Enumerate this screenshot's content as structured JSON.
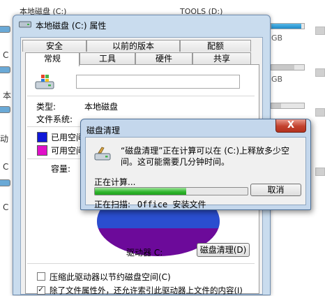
{
  "background": {
    "drive_c_label": "本地磁盘 (C:)",
    "drive_d_label": "TOOLS (D:)",
    "gb_text": "GB",
    "edge_letters": [
      "C",
      "C",
      "本",
      "动",
      "C",
      "C"
    ],
    "bar_fill_fractions": [
      0.92,
      0.7,
      0.3
    ]
  },
  "properties_window": {
    "title": "本地磁盘 (C:) 属性",
    "tabs_row1": [
      "安全",
      "以前的版本",
      "配额"
    ],
    "tabs_row2": [
      "常规",
      "工具",
      "硬件",
      "共享"
    ],
    "active_tab": "常规",
    "name_value": "",
    "type_label": "类型:",
    "type_value": "本地磁盘",
    "filesystem_label": "文件系统:",
    "used_label": "已用空间",
    "free_label": "可用空间",
    "used_color": "#1018d8",
    "free_color": "#e010c8",
    "capacity_label": "容量:",
    "drive_label": "驱动器 C:",
    "cleanup_button": "磁盘清理(D)",
    "compress_checkbox": "压缩此驱动器以节约磁盘空间(C)",
    "compress_checked": false,
    "index_checkbox": "除了文件属性外，还允许索引此驱动器上文件的内容(I)",
    "index_checked": true
  },
  "cleanup_dialog": {
    "title": "磁盘清理",
    "close_symbol": "X",
    "message": "“磁盘清理”正在计算可以在 (C:)上释放多少空间。这可能需要几分钟时间。",
    "status": "正在计算...",
    "progress_fraction": 0.6,
    "cancel_button": "取消",
    "scanning_label": "正在扫描:",
    "scanning_item": "Office 安装文件"
  }
}
